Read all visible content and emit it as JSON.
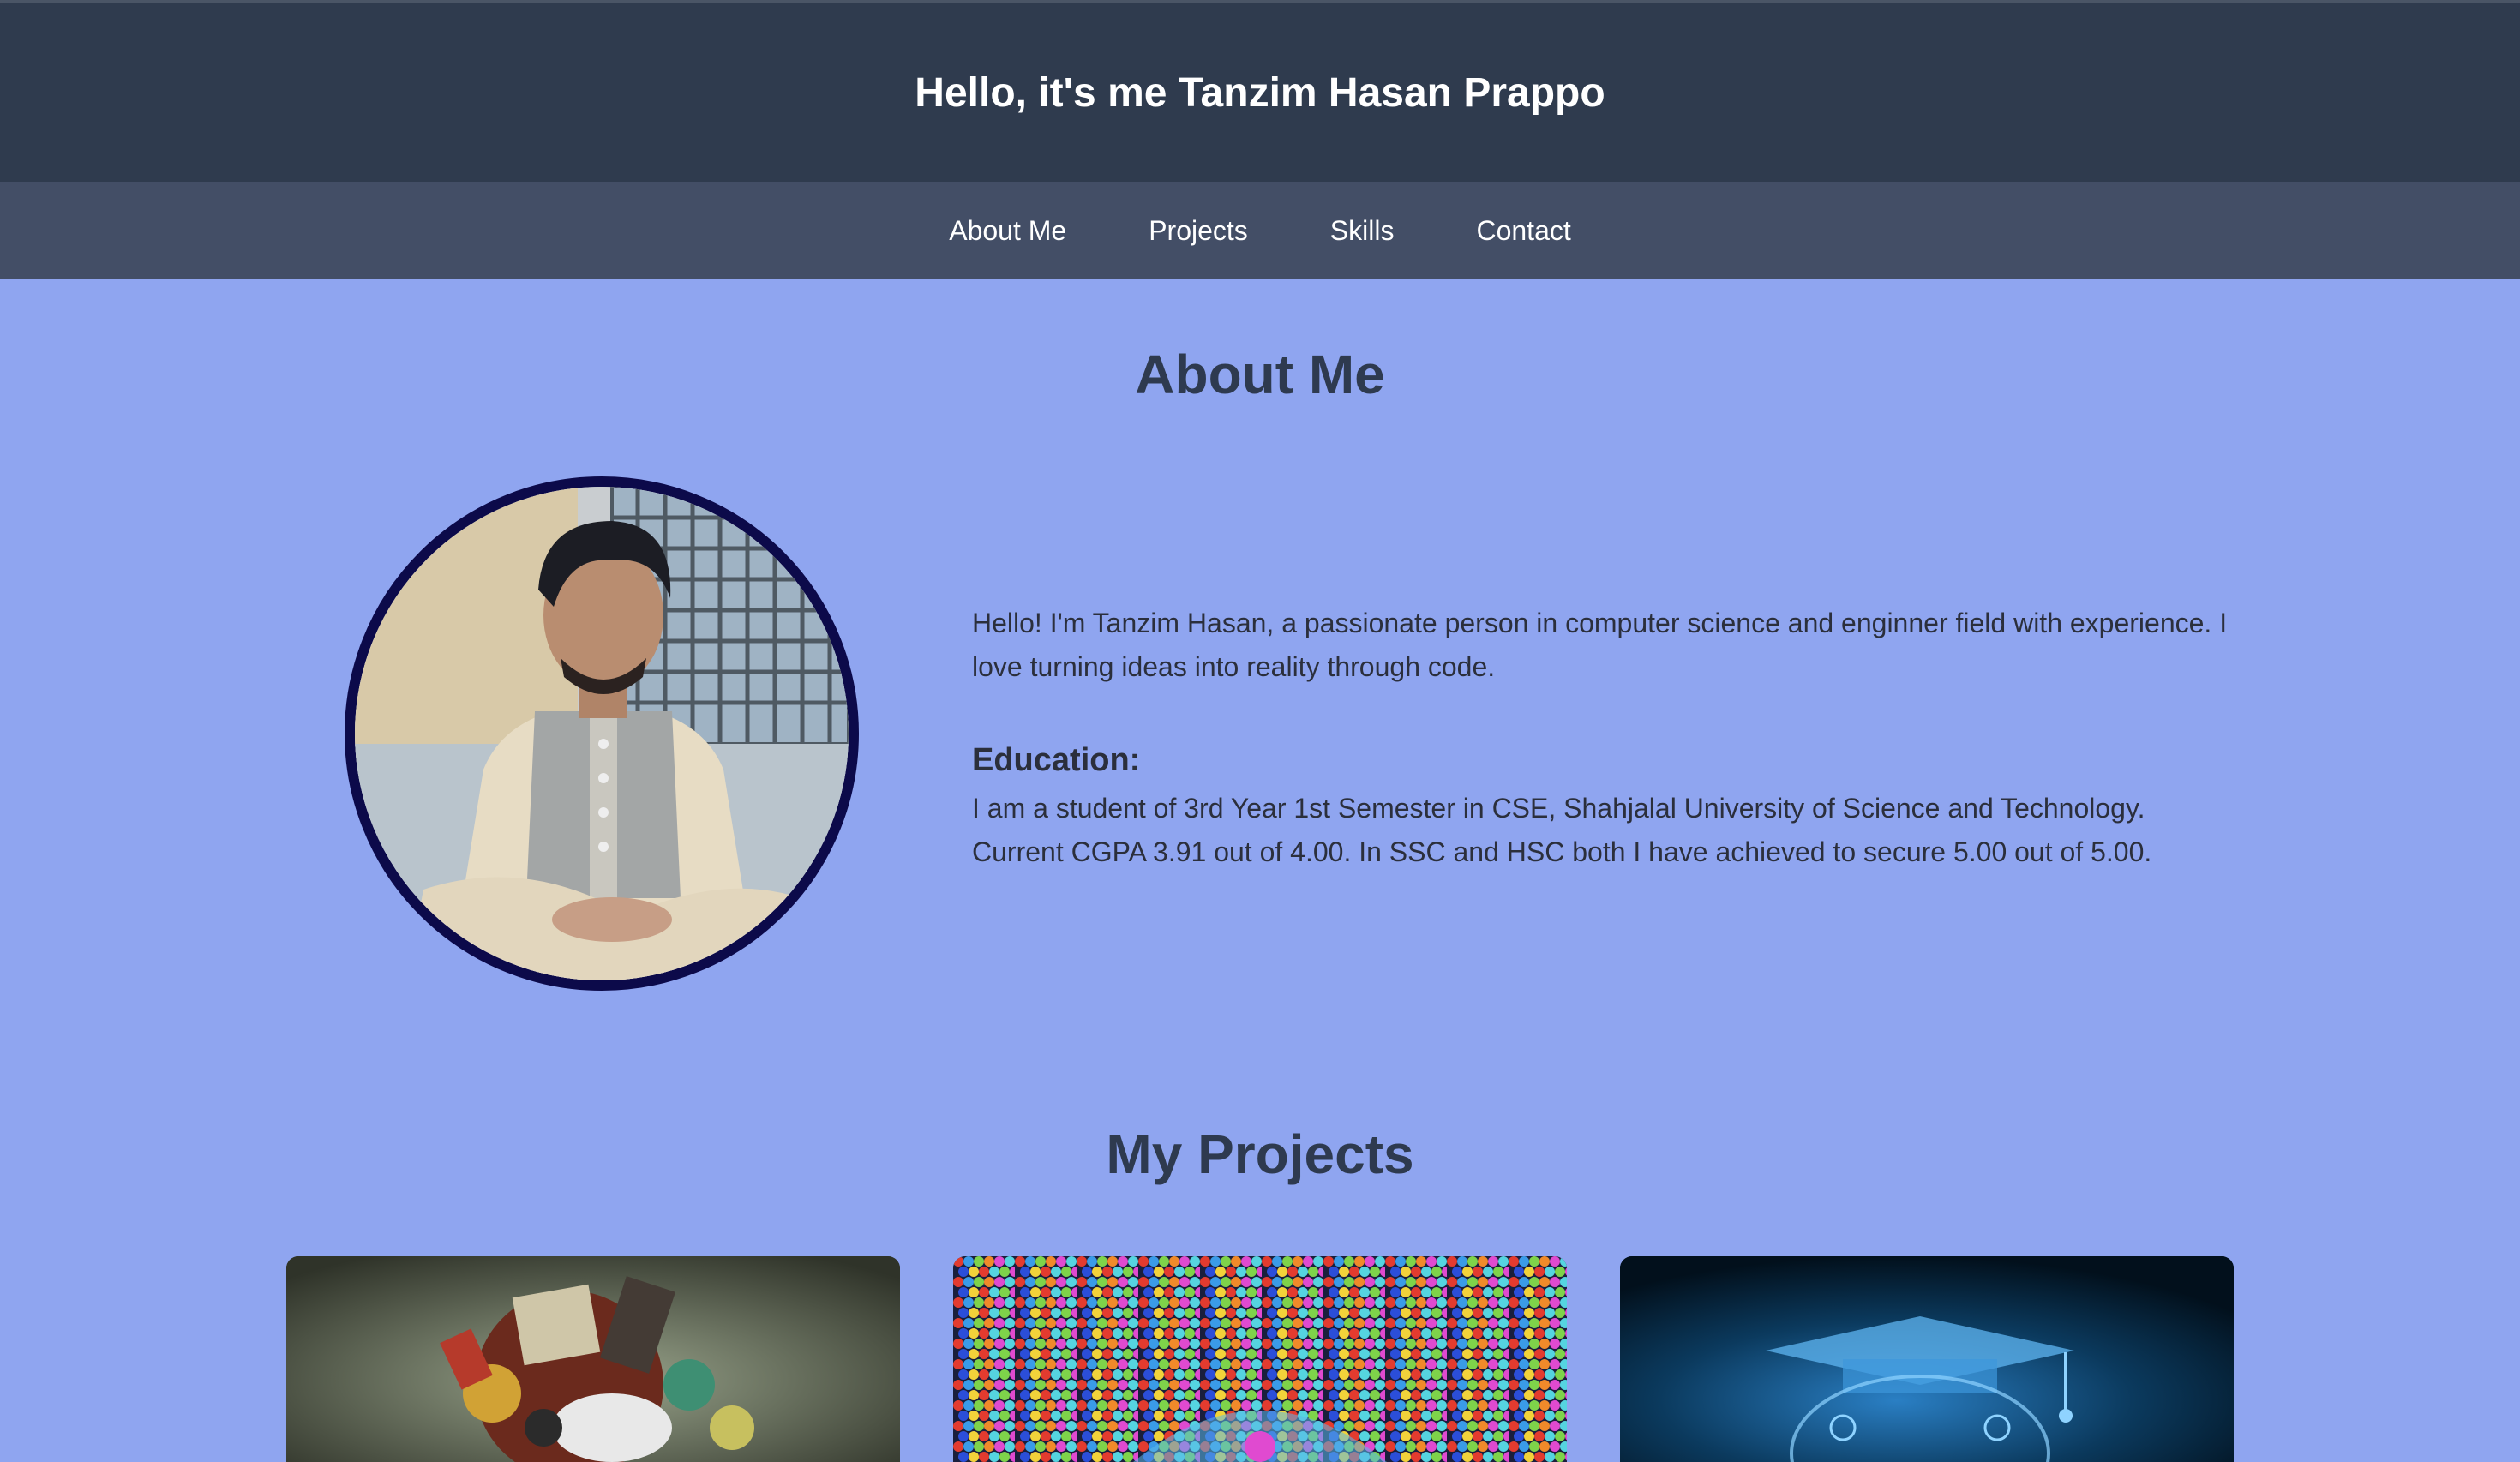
{
  "header": {
    "title": "Hello, it's me Tanzim Hasan Prappo"
  },
  "nav": {
    "items": [
      {
        "label": "About Me"
      },
      {
        "label": "Projects"
      },
      {
        "label": "Skills"
      },
      {
        "label": "Contact"
      }
    ]
  },
  "about": {
    "title": "About Me",
    "intro": "Hello! I'm Tanzim Hasan, a passionate person in computer science and enginner field with experience. I love turning ideas into reality through code.",
    "education_heading": "Education:",
    "education_text": "I am a student of 3rd Year 1st Semester in CSE, Shahjalal University of Science and Technology. Current CGPA 3.91 out of 4.00. In SSC and HSC both I have achieved to secure 5.00 out of 5.00."
  },
  "projects": {
    "title": "My Projects",
    "cards": [
      {
        "image": "gadgets-collage"
      },
      {
        "image": "bubble-shooter-game"
      },
      {
        "image": "graduation-cap-tech"
      }
    ]
  },
  "colors": {
    "header_bg": "#2f3b4e",
    "nav_bg": "#434e66",
    "page_bg": "#8fa5f0",
    "heading_text": "#2e3a4f",
    "avatar_border": "#0c0a4a"
  }
}
